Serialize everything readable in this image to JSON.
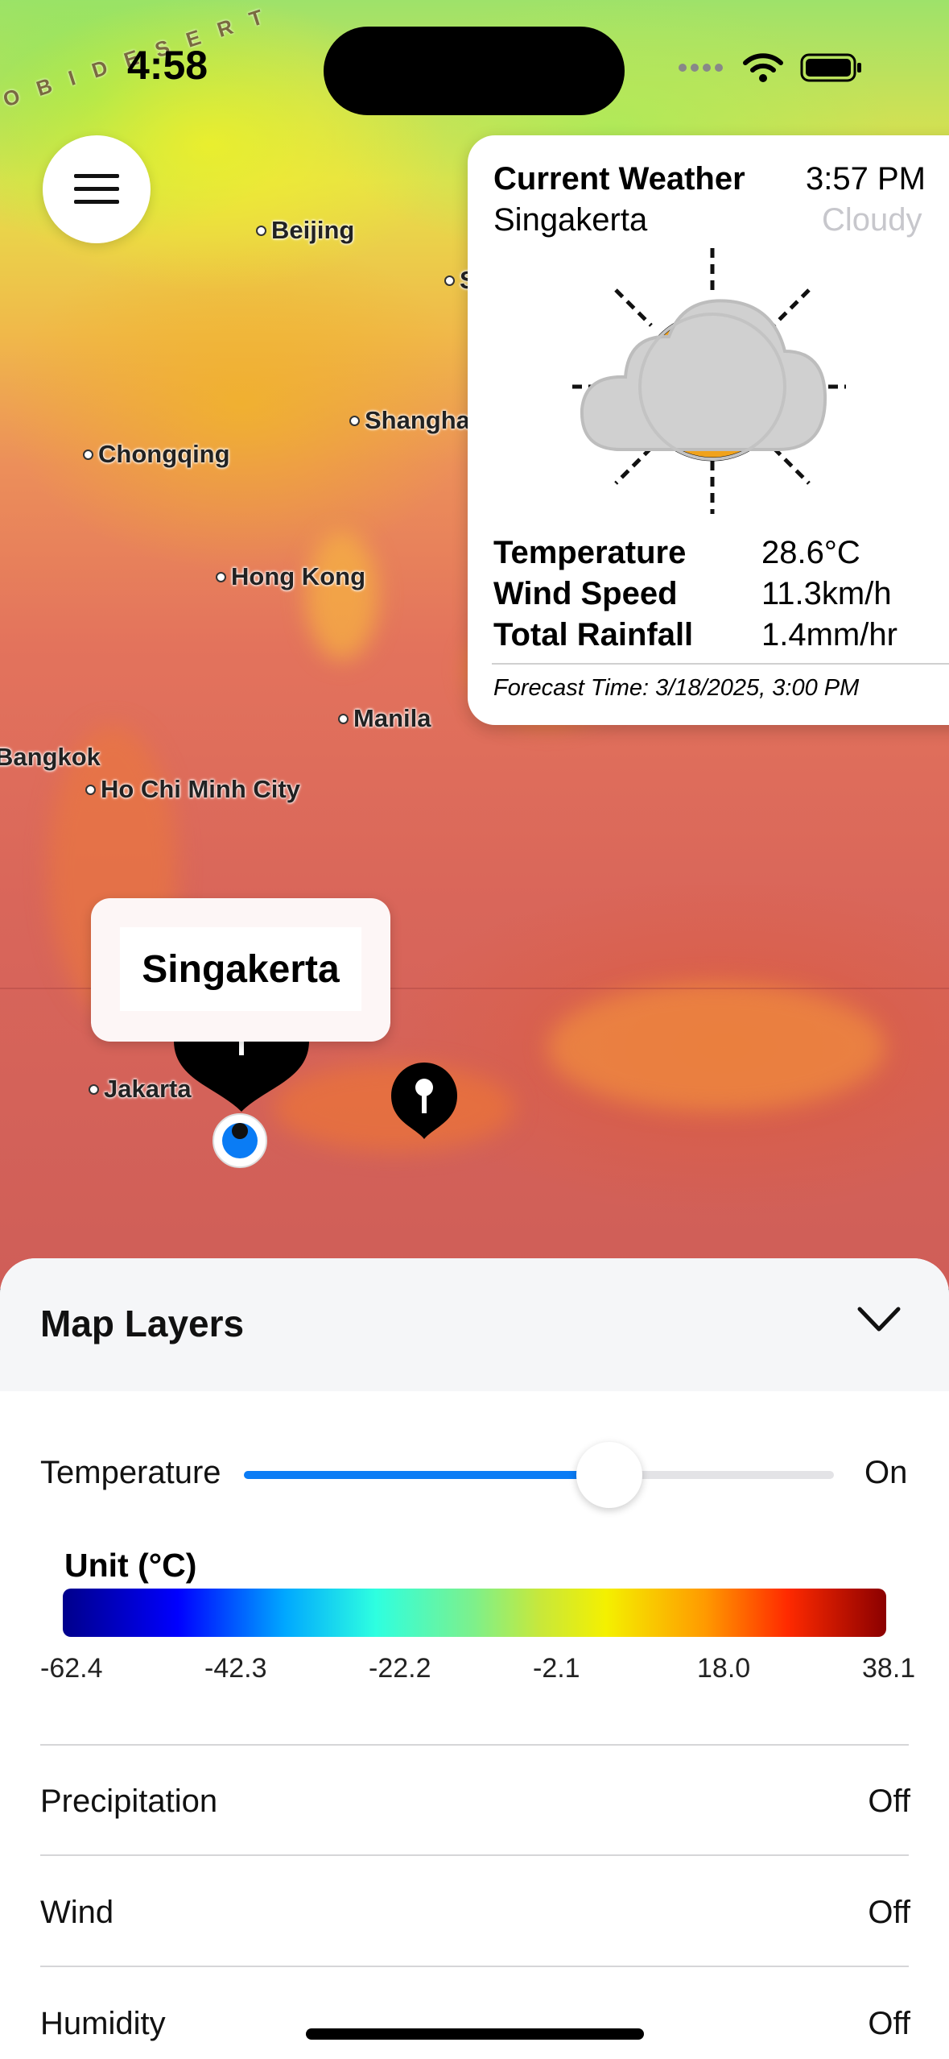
{
  "status_bar": {
    "time": "4:58"
  },
  "map": {
    "desert_label": "O B I  D E S E R T",
    "cities": [
      {
        "name": "Beijing"
      },
      {
        "name": "Shanghai"
      },
      {
        "name": "Chongqing"
      },
      {
        "name": "Hong Kong"
      },
      {
        "name": "Manila"
      },
      {
        "name": "Bangkok"
      },
      {
        "name": "Ho Chi Minh City"
      },
      {
        "name": "Jakarta"
      },
      {
        "name": "S"
      }
    ]
  },
  "weather_card": {
    "title": "Current Weather",
    "time": "3:57 PM",
    "location": "Singakerta",
    "condition": "Cloudy",
    "icon": "partly-cloudy-icon",
    "temperature_label": "Temperature",
    "temperature_value": "28.6°C",
    "wind_label": "Wind Speed",
    "wind_value": "11.3km/h",
    "rain_label": "Total Rainfall",
    "rain_value": "1.4mm/hr",
    "forecast_time": "Forecast Time: 3/18/2025, 3:00 PM"
  },
  "callout": {
    "label": "Singakerta"
  },
  "sheet": {
    "title": "Map Layers",
    "temperature": {
      "label": "Temperature",
      "state": "On",
      "slider_fraction": 0.62
    },
    "unit_label": "Unit (°C)",
    "scale_ticks": [
      "-62.4",
      "-42.3",
      "-22.2",
      "-2.1",
      "18.0",
      "38.1"
    ],
    "layers": [
      {
        "label": "Precipitation",
        "state": "Off"
      },
      {
        "label": "Wind",
        "state": "Off"
      },
      {
        "label": "Humidity",
        "state": "Off"
      }
    ]
  },
  "colors": {
    "accent": "#0a7cf5",
    "card_bg": "#ffffff",
    "sheet_header_bg": "#f5f6f8"
  }
}
